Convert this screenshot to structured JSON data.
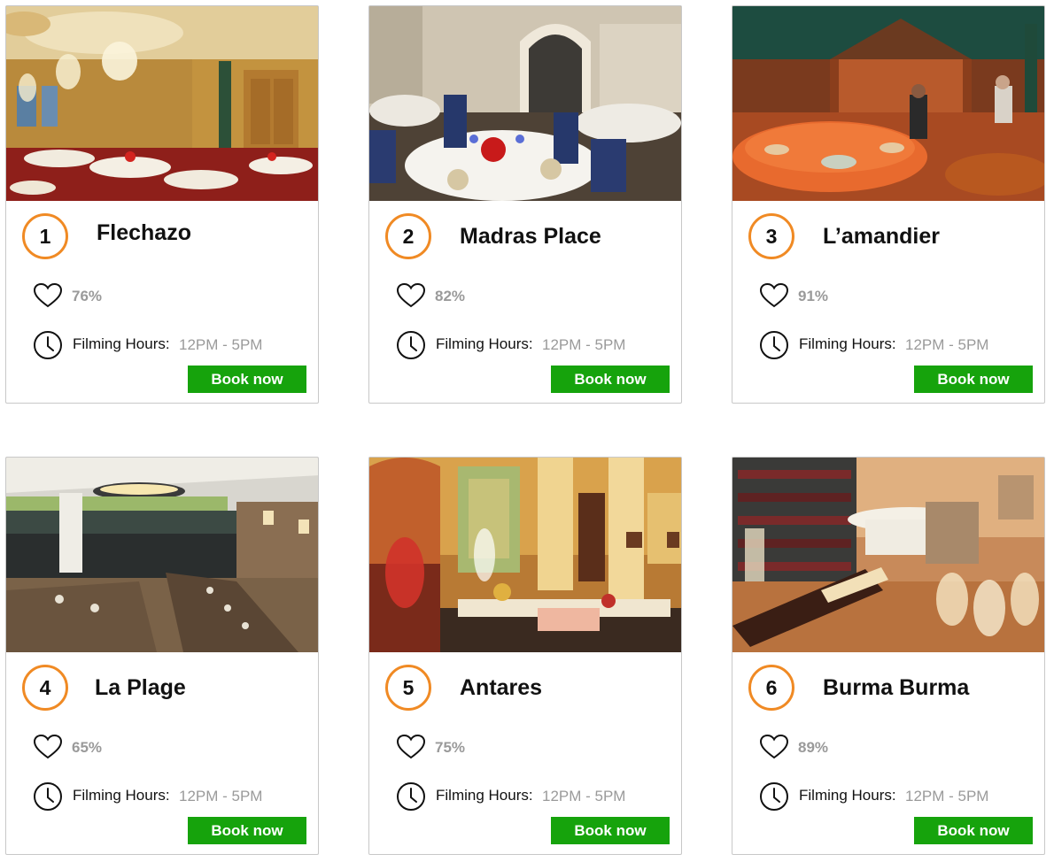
{
  "restaurants": [
    {
      "rank": "1",
      "name": "Flechazo",
      "likes": "76%",
      "hours_label": "Filming Hours:",
      "hours": "12PM - 5PM",
      "book_label": "Book now"
    },
    {
      "rank": "2",
      "name": "Madras Place",
      "likes": "82%",
      "hours_label": "Filming Hours:",
      "hours": "12PM - 5PM",
      "book_label": "Book now"
    },
    {
      "rank": "3",
      "name": "L’amandier",
      "likes": "91%",
      "hours_label": "Filming Hours:",
      "hours": "12PM - 5PM",
      "book_label": "Book now"
    },
    {
      "rank": "4",
      "name": "La Plage",
      "likes": "65%",
      "hours_label": "Filming Hours:",
      "hours": "12PM - 5PM",
      "book_label": "Book now"
    },
    {
      "rank": "5",
      "name": "Antares",
      "likes": "75%",
      "hours_label": "Filming Hours:",
      "hours": "12PM - 5PM",
      "book_label": "Book now"
    },
    {
      "rank": "6",
      "name": "Burma Burma",
      "likes": "89%",
      "hours_label": "Filming Hours:",
      "hours": "12PM - 5PM",
      "book_label": "Book now"
    }
  ],
  "icons": {
    "likes": "heart-icon",
    "hours": "clock-icon"
  },
  "colors": {
    "rank_ring": "#f08a24",
    "book_button": "#16a30c",
    "muted_text": "#9a9a9a"
  }
}
